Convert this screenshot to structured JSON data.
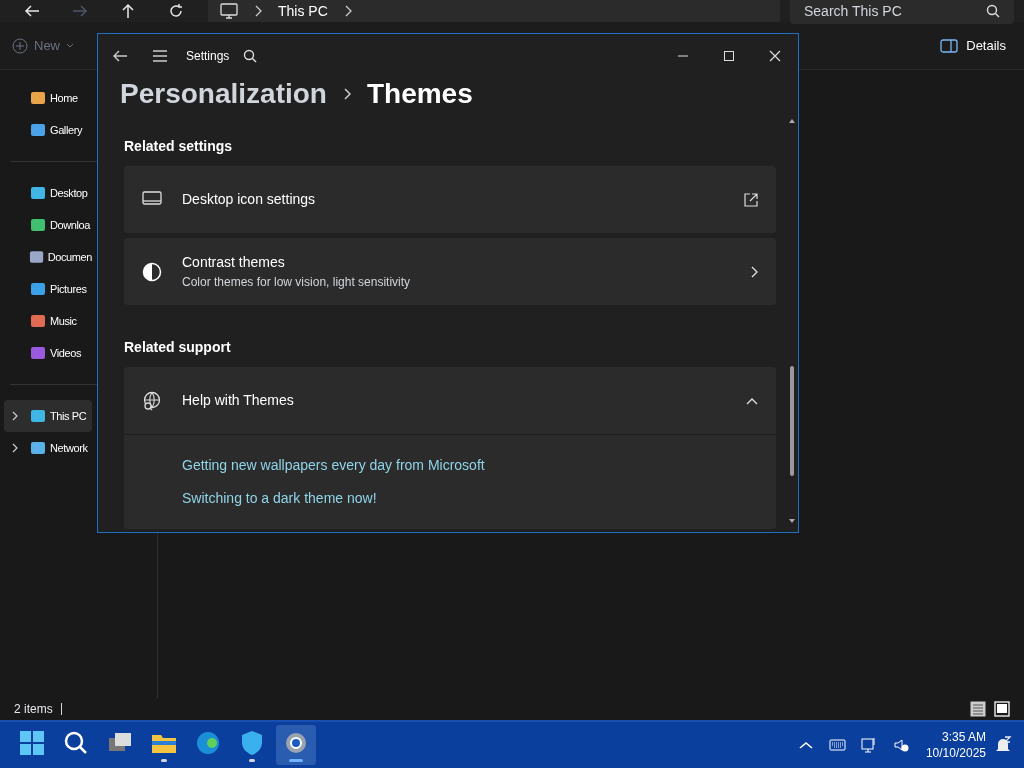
{
  "explorer": {
    "nav": [
      {
        "kind": "back",
        "disabled": false
      },
      {
        "kind": "forward",
        "disabled": true
      },
      {
        "kind": "up",
        "disabled": false
      },
      {
        "kind": "refresh",
        "disabled": false
      }
    ],
    "address": [
      "This PC"
    ],
    "search": {
      "placeholder": "Search This PC"
    },
    "new_button": {
      "label": "New",
      "disabled": true
    },
    "details_button": {
      "label": "Details"
    },
    "sidebar": [
      [
        {
          "label": "Home",
          "selected": false
        },
        {
          "label": "Gallery",
          "selected": false
        }
      ],
      [
        {
          "label": "Desktop",
          "selected": false
        },
        {
          "label": "Downloa",
          "selected": false
        },
        {
          "label": "Documen",
          "selected": false
        },
        {
          "label": "Pictures",
          "selected": false
        },
        {
          "label": "Music",
          "selected": false
        },
        {
          "label": "Videos",
          "selected": false
        }
      ],
      [
        {
          "label": "This PC",
          "selected": true,
          "expandable": true
        },
        {
          "label": "Network",
          "selected": false,
          "expandable": true
        }
      ]
    ],
    "status": "2 items"
  },
  "settings": {
    "title": "Settings",
    "breadcrumb": {
      "parent": "Personalization",
      "current": "Themes"
    },
    "sections": [
      {
        "heading": "Related settings",
        "items": [
          {
            "kind": "external",
            "title": "Desktop icon settings"
          },
          {
            "kind": "link",
            "title": "Contrast themes",
            "subtitle": "Color themes for low vision, light sensitivity"
          }
        ]
      },
      {
        "heading": "Related support",
        "items": [
          {
            "kind": "expander",
            "title": "Help with Themes",
            "expanded": true,
            "links": [
              "Getting new wallpapers every day from Microsoft",
              "Switching to a dark theme now!"
            ]
          }
        ]
      }
    ]
  },
  "taskbar": {
    "apps": [
      {
        "kind": "start",
        "running": false,
        "selected": false
      },
      {
        "kind": "search",
        "running": false,
        "selected": false
      },
      {
        "kind": "taskview",
        "running": false,
        "selected": false
      },
      {
        "kind": "explorer",
        "running": true,
        "selected": false
      },
      {
        "kind": "edge",
        "running": false,
        "selected": false
      },
      {
        "kind": "defender",
        "running": true,
        "selected": false
      },
      {
        "kind": "settings",
        "running": true,
        "selected": true
      }
    ],
    "time": "3:35 AM",
    "date": "10/10/2025"
  }
}
